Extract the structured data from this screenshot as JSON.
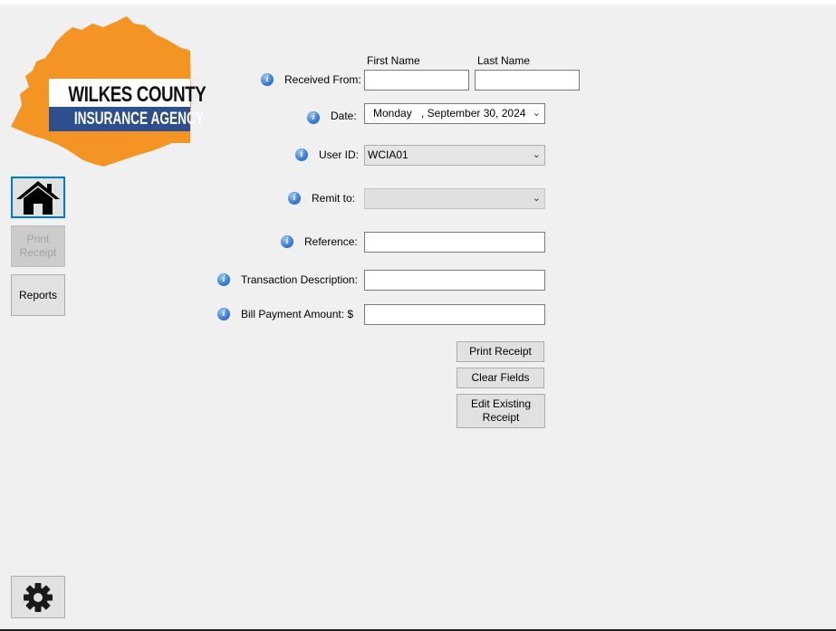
{
  "logo": {
    "line1": "WILKES COUNTY",
    "line2": "INSURANCE AGENCY",
    "colors": {
      "shape": "#f39424",
      "banner": "#2d4f8e"
    }
  },
  "sidebar": {
    "home_icon": "house-icon",
    "print_receipt": "Print Receipt",
    "reports": "Reports",
    "settings_icon": "gear-icon"
  },
  "form": {
    "first_name_header": "First Name",
    "last_name_header": "Last Name",
    "received_from_label": "Received From:",
    "date_label": "Date:",
    "date_weekday": "Monday",
    "date_rest": ", September 30, 2024",
    "user_id_label": "User ID:",
    "user_id_value": "WCIA01",
    "remit_to_label": "Remit to:",
    "remit_to_value": "",
    "reference_label": "Reference:",
    "transaction_description_label": "Transaction Description:",
    "bill_payment_amount_label": "Bill Payment Amount: $",
    "first_name_value": "",
    "last_name_value": "",
    "reference_value": "",
    "transaction_description_value": "",
    "bill_payment_amount_value": ""
  },
  "actions": {
    "print_receipt": "Print Receipt",
    "clear_fields": "Clear Fields",
    "edit_existing_receipt": "Edit Existing Receipt"
  }
}
